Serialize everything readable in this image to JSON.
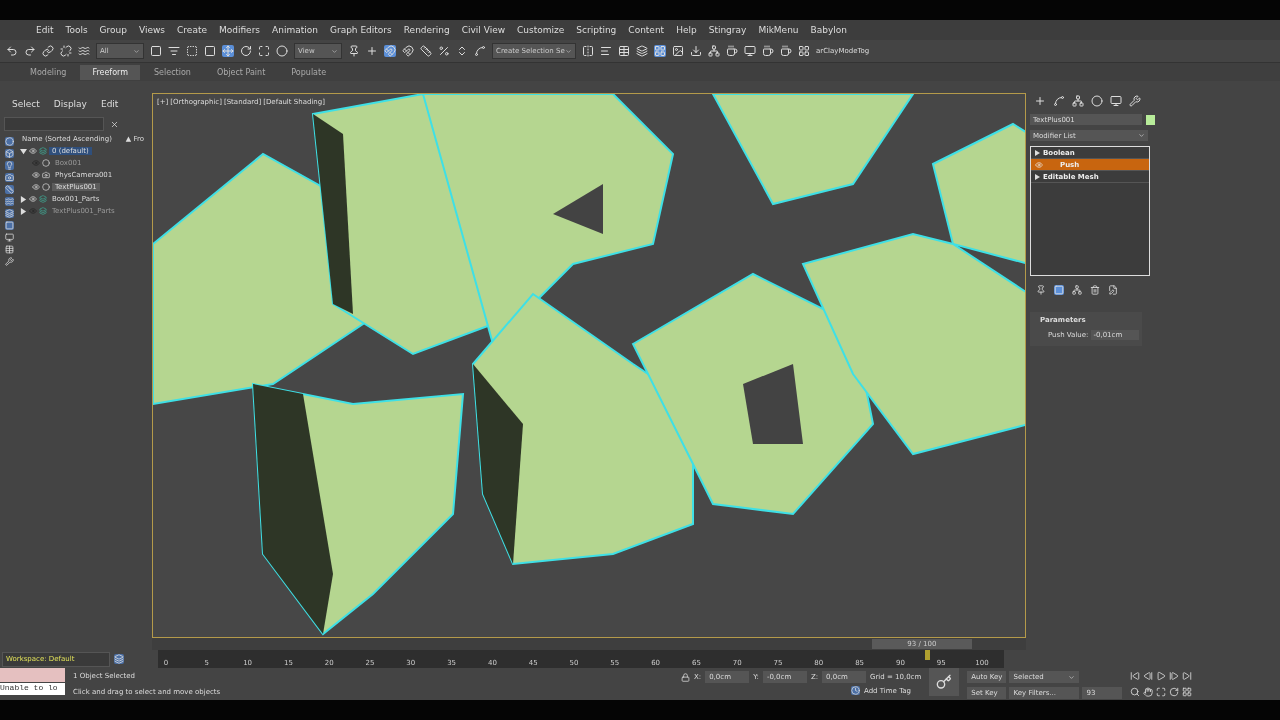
{
  "menu": [
    "Edit",
    "Tools",
    "Group",
    "Views",
    "Create",
    "Modifiers",
    "Animation",
    "Graph Editors",
    "Rendering",
    "Civil View",
    "Customize",
    "Scripting",
    "Content",
    "Help",
    "Stingray",
    "MikMenu",
    "Babylon"
  ],
  "toolbar": {
    "selection_filter": "All",
    "reference_coord": "View",
    "named_selection": "Create Selection Se",
    "script_button": "arClayModeTog"
  },
  "ribbon_tabs": [
    {
      "label": "Modeling",
      "selected": false
    },
    {
      "label": "Freeform",
      "selected": true
    },
    {
      "label": "Selection",
      "selected": false
    },
    {
      "label": "Object Paint",
      "selected": false
    },
    {
      "label": "Populate",
      "selected": false
    }
  ],
  "scene_explorer": {
    "menu": [
      "Select",
      "Display",
      "Edit"
    ],
    "column_name": "Name (Sorted Ascending)",
    "column_2": "▲ Fro",
    "tree": [
      {
        "label": "0 (default)",
        "kind": "layer",
        "visible": true,
        "selected": true,
        "expanded": true,
        "children": [
          {
            "label": "Box001",
            "kind": "object",
            "visible": false,
            "selected": false
          },
          {
            "label": "PhysCamera001",
            "kind": "camera",
            "visible": true,
            "selected": false
          },
          {
            "label": "TextPlus001",
            "kind": "object",
            "visible": true,
            "selected": true
          }
        ]
      },
      {
        "label": "Box001_Parts",
        "kind": "layer",
        "visible": true,
        "selected": false,
        "expanded": false
      },
      {
        "label": "TextPlus001_Parts",
        "kind": "layer",
        "visible": false,
        "selected": false,
        "expanded": false
      }
    ]
  },
  "viewport": {
    "labels": [
      "[+]",
      "[Orthographic]",
      "[Standard]",
      "[Default Shading]"
    ]
  },
  "command_panel": {
    "object_name": "TextPlus001",
    "modifier_list": "Modifier List",
    "stack": [
      {
        "label": "Boolean",
        "selected": false,
        "kind": "expandable"
      },
      {
        "label": "Push",
        "selected": true,
        "kind": "modifier"
      },
      {
        "label": "Editable Mesh",
        "selected": false,
        "kind": "expandable"
      }
    ],
    "rollout": "Parameters",
    "field_label": "Push Value:",
    "field_value": "-0,01cm"
  },
  "time_slider": {
    "reading": "93 / 100",
    "level": 0.93
  },
  "track_bar": {
    "ticks": [
      "0",
      "5",
      "10",
      "15",
      "20",
      "25",
      "30",
      "35",
      "40",
      "45",
      "50",
      "55",
      "60",
      "65",
      "70",
      "75",
      "80",
      "85",
      "90",
      "95",
      "100"
    ],
    "level": 0.93
  },
  "status": {
    "workspace": "Workspace: Default",
    "maxscript": "Unable to lo",
    "selection": "1 Object Selected",
    "prompt": "Click and drag to select and move objects",
    "x_label": "X:",
    "x": "0,0cm",
    "y_label": "Y:",
    "y": "-0,0cm",
    "z_label": "Z:",
    "z": "0,0cm",
    "grid": "Grid = 10,0cm",
    "time_tag": "Add Time Tag",
    "auto_key": "Auto Key",
    "key_mode": "Selected",
    "set_key": "Set Key",
    "key_filters": "Key Filters...",
    "frame": "93"
  }
}
